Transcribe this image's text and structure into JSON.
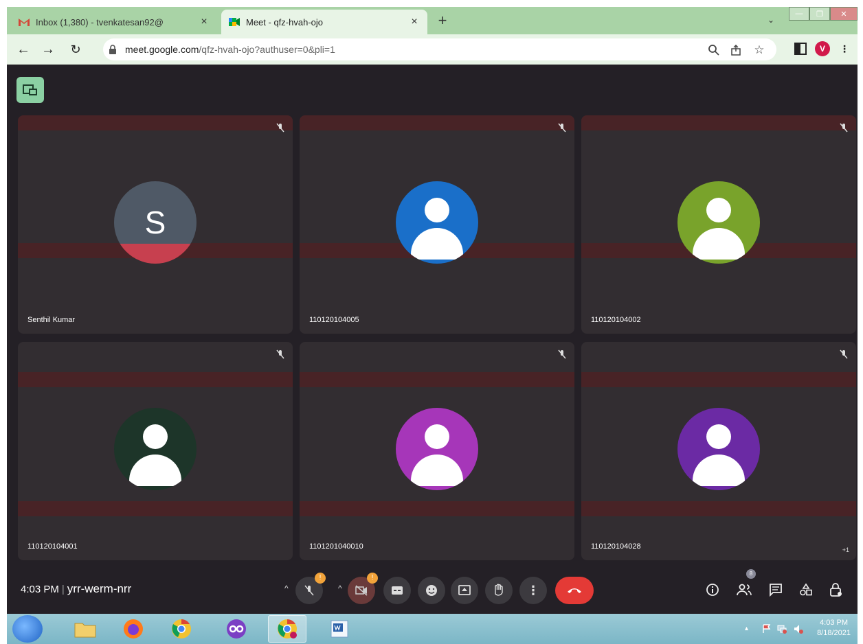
{
  "browser": {
    "tabs": [
      {
        "title": "Inbox (1,380) - tvenkatesan92@",
        "active": false
      },
      {
        "title": "Meet - qfz-hvah-ojo",
        "active": true
      }
    ],
    "new_tab": "+",
    "tab_search": "⌄",
    "url_host": "meet.google.com",
    "url_path": "/qfz-hvah-ojo?authuser=0&pli=1",
    "profile_initial": "V",
    "colors": {
      "frame": "#a9d3a6",
      "toolbar": "#e8f4e6"
    }
  },
  "meet": {
    "tiles": [
      {
        "name": "Senthil Kumar",
        "initial": "S",
        "avatar_color": "#4f5966",
        "accent": "#c7404f"
      },
      {
        "name": "110120104005",
        "initial": "",
        "avatar_color": "#1a6fc9"
      },
      {
        "name": "110120104002",
        "initial": "",
        "avatar_color": "#79a32b"
      },
      {
        "name": "110120104001",
        "initial": "",
        "avatar_color": "#1d3529"
      },
      {
        "name": "1101201040010",
        "initial": "",
        "avatar_color": "#a636b9"
      },
      {
        "name": "110120104028",
        "initial": "",
        "avatar_color": "#6b2aa4",
        "extra": "+1"
      }
    ],
    "time": "4:03 PM",
    "separator": "|",
    "meeting_code": "yrr-werm-nrr",
    "mic_badge": "!",
    "cam_badge": "!",
    "people_count": "8",
    "colors": {
      "background": "#242026",
      "tile": "#322d31",
      "end_call": "#e43a36"
    }
  },
  "taskbar": {
    "clock_time": "4:03 PM",
    "clock_date": "8/18/2021"
  }
}
